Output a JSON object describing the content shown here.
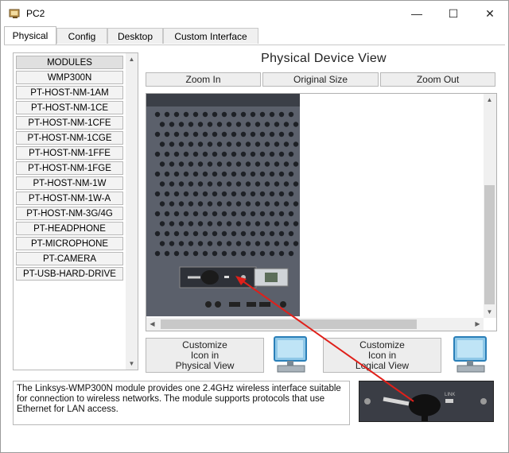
{
  "window": {
    "title": "PC2",
    "minimize_glyph": "—",
    "maximize_glyph": "☐",
    "close_glyph": "✕"
  },
  "tabs": [
    {
      "label": "Physical",
      "active": true
    },
    {
      "label": "Config",
      "active": false
    },
    {
      "label": "Desktop",
      "active": false
    },
    {
      "label": "Custom Interface",
      "active": false
    }
  ],
  "modules": {
    "header": "MODULES",
    "items": [
      "WMP300N",
      "PT-HOST-NM-1AM",
      "PT-HOST-NM-1CE",
      "PT-HOST-NM-1CFE",
      "PT-HOST-NM-1CGE",
      "PT-HOST-NM-1FFE",
      "PT-HOST-NM-1FGE",
      "PT-HOST-NM-1W",
      "PT-HOST-NM-1W-A",
      "PT-HOST-NM-3G/4G",
      "PT-HEADPHONE",
      "PT-MICROPHONE",
      "PT-CAMERA",
      "PT-USB-HARD-DRIVE"
    ]
  },
  "view": {
    "title": "Physical Device View",
    "zoom_in": "Zoom In",
    "original_size": "Original Size",
    "zoom_out": "Zoom Out"
  },
  "customize_physical": [
    "Customize",
    "Icon in",
    "Physical View"
  ],
  "customize_logical": [
    "Customize",
    "Icon in",
    "Logical View"
  ],
  "description": "The Linksys-WMP300N module provides one 2.4GHz wireless interface suitable for connection to wireless networks. The module supports protocols that use Ethernet for LAN access.",
  "thumb_label": "LINK",
  "colors": {
    "arrow": "#e0201a",
    "device_body": "#5b606b",
    "device_top": "#3b3f47",
    "accent_pc": "#2aa7e0"
  },
  "icons": {
    "app": "packet-tracer-icon",
    "pc": "pc-monitor-icon"
  }
}
